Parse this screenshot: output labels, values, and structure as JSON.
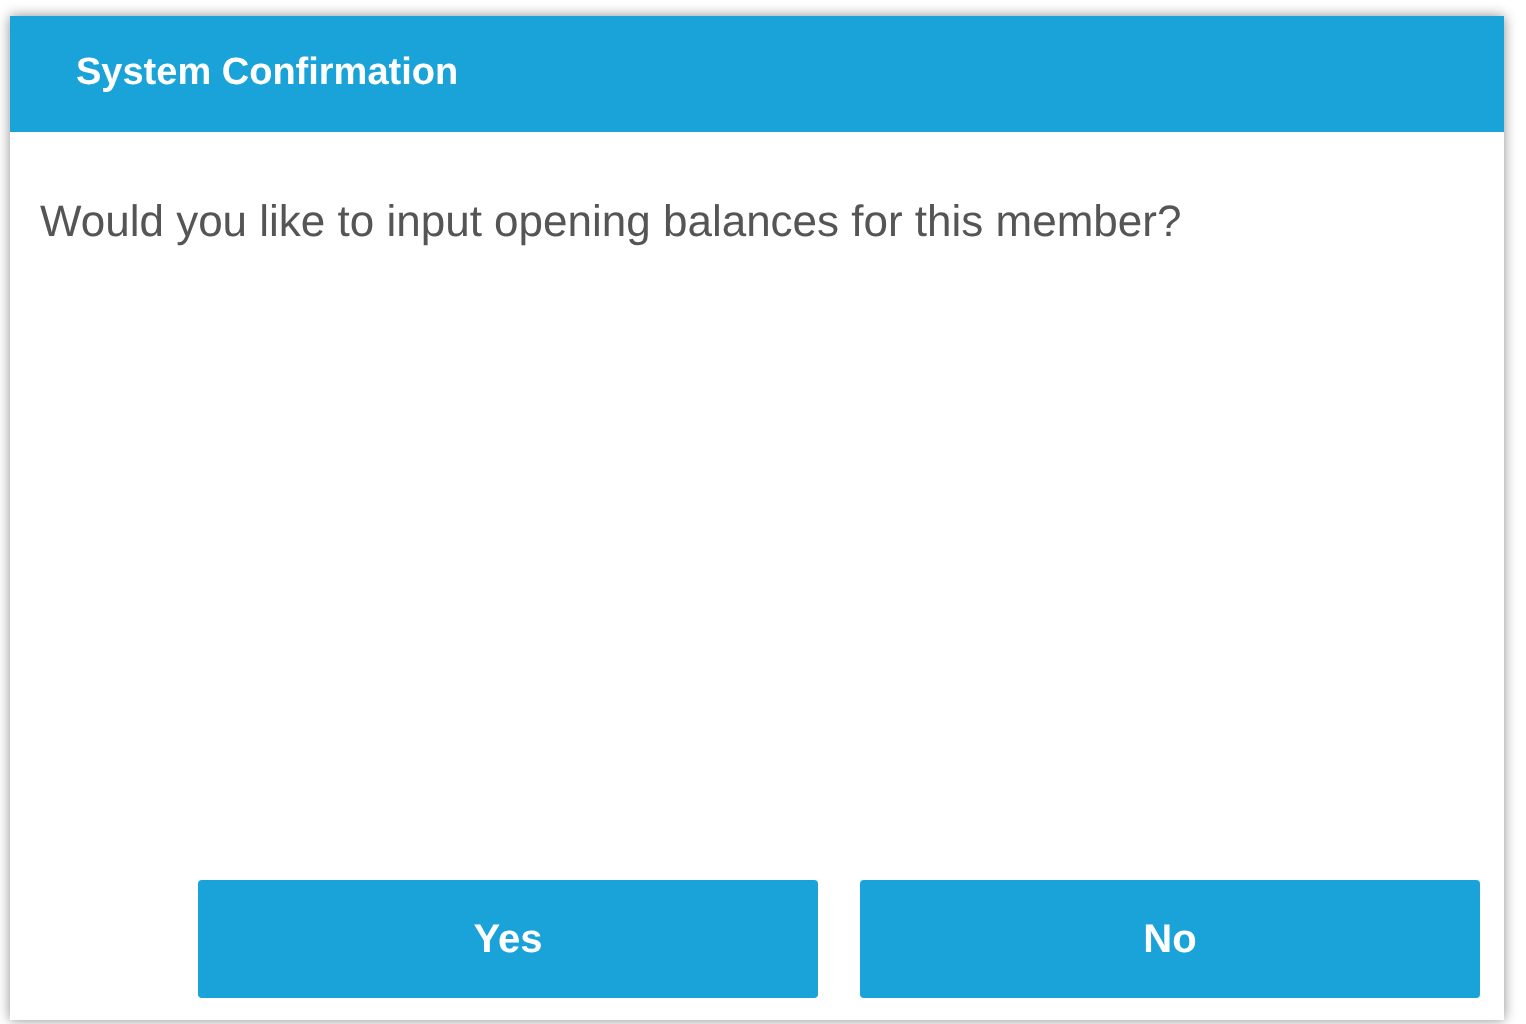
{
  "dialog": {
    "title": "System Confirmation",
    "message": "Would you like to input opening balances for this member?",
    "buttons": [
      "Yes",
      "No"
    ]
  }
}
